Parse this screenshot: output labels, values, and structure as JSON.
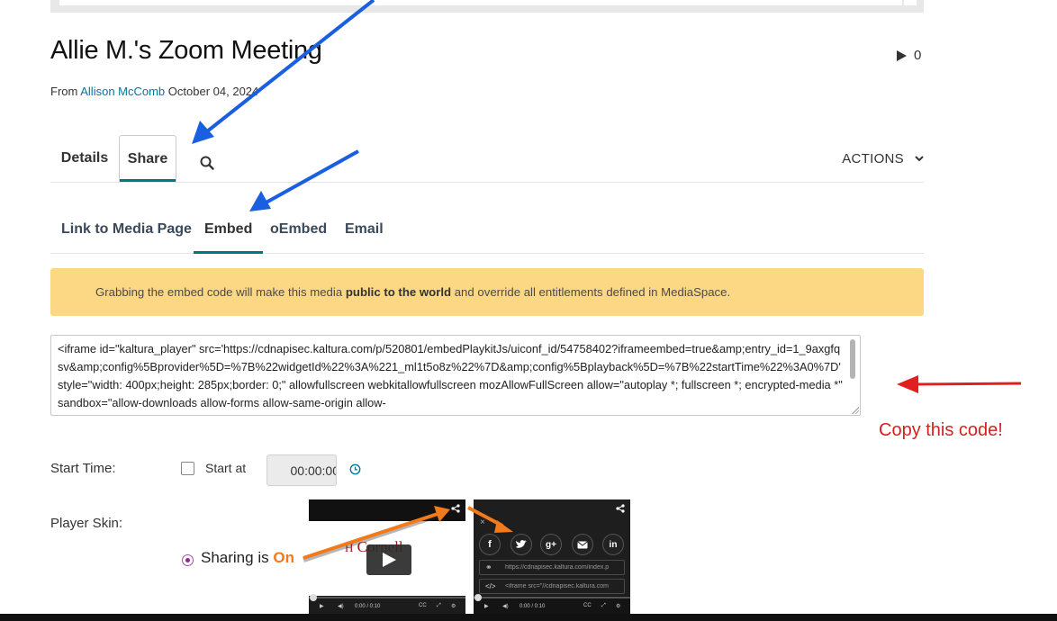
{
  "media": {
    "title": "Allie M.'s Zoom Meeting",
    "play_count": "0",
    "from_label": "From",
    "author": "Allison McComb",
    "date": "October 04, 2024"
  },
  "tabs": {
    "details": "Details",
    "share": "Share",
    "actions": "ACTIONS"
  },
  "share_tabs": [
    {
      "label": "Link to Media Page"
    },
    {
      "label": "Embed"
    },
    {
      "label": "oEmbed"
    },
    {
      "label": "Email"
    }
  ],
  "warning": {
    "prefix": "Grabbing the embed code will make this media",
    "bold": "public to the world",
    "suffix": "and override all entitlements defined in MediaSpace."
  },
  "embed_code": "<iframe id=\"kaltura_player\" src='https://cdnapisec.kaltura.com/p/520801/embedPlaykitJs/uiconf_id/54758402?iframeembed=true&amp;entry_id=1_9axgfqsv&amp;config%5Bprovider%5D=%7B%22widgetId%22%3A%221_ml1t5o8z%22%7D&amp;config%5Bplayback%5D=%7B%22startTime%22%3A0%7D'  style=\"width: 400px;height: 285px;border: 0;\" allowfullscreen webkitallowfullscreen mozAllowFullScreen allow=\"autoplay *; fullscreen *; encrypted-media *\" sandbox=\"allow-downloads allow-forms allow-same-origin allow-",
  "annotation": "Copy this code!",
  "start_time": {
    "label": "Start Time:",
    "checkbox_label": "Start at",
    "value": "00:00:00"
  },
  "player_skin": {
    "label": "Player Skin:",
    "sharing_prefix": "Sharing is",
    "sharing_state": "On",
    "skin1_brand": "Cornell",
    "skin1_time": "0:00 / 0:10",
    "skin2_time": "0:00 / 0:10",
    "skin2_link": "https://cdnapisec.kaltura.com/index.p",
    "skin2_embed": "<iframe src=\"//cdnapisec.kaltura.com"
  },
  "colors": {
    "teal_accent": "#00797e",
    "warning_bg": "#fcd884",
    "annotation_red": "#d62020",
    "arrow_blue": "#1a5fe0",
    "arrow_orange": "#f27a1a"
  }
}
